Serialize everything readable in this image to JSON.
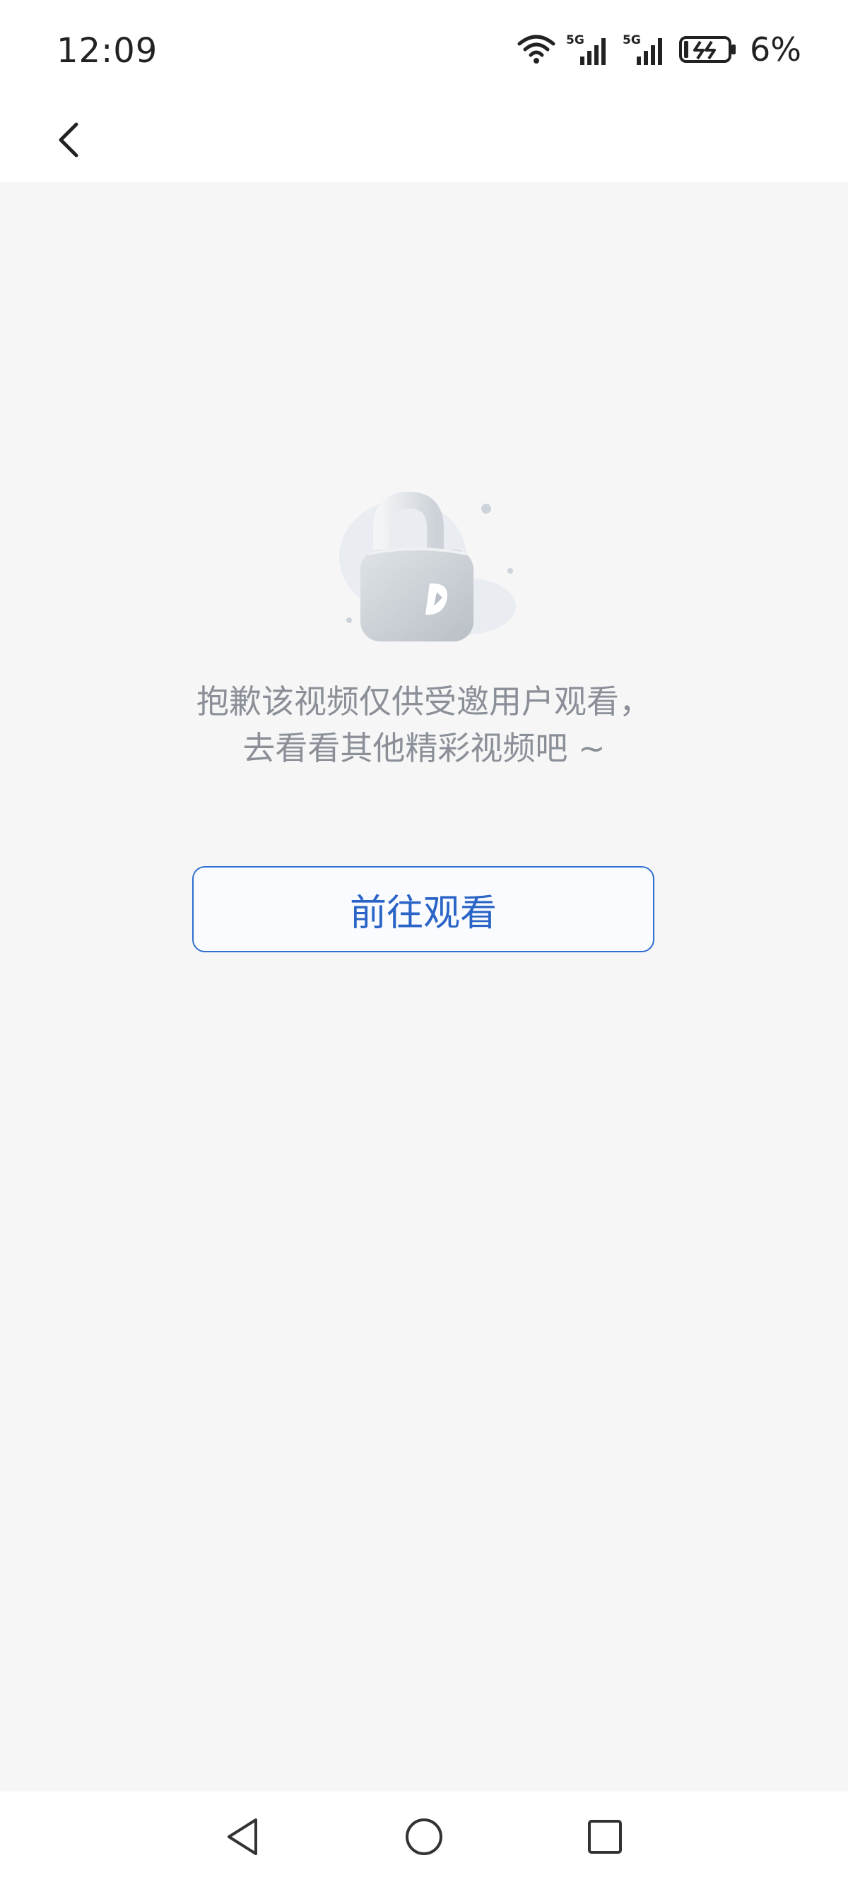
{
  "status_bar": {
    "time": "12:09",
    "network_1": "5G",
    "network_2": "5G",
    "battery_percent": "6%"
  },
  "navigation": {
    "back_icon": "chevron-left-icon"
  },
  "message": {
    "line1": "抱歉该视频仅供受邀用户观看，",
    "line2": "去看看其他精彩视频吧 ~"
  },
  "button": {
    "label": "前往观看"
  },
  "system_nav": {
    "back": "triangle-back-icon",
    "home": "circle-home-icon",
    "recents": "square-recents-icon"
  },
  "colors": {
    "accent": "#2f6fd1",
    "background": "#f6f6f6",
    "text_muted": "#8a8f98"
  }
}
